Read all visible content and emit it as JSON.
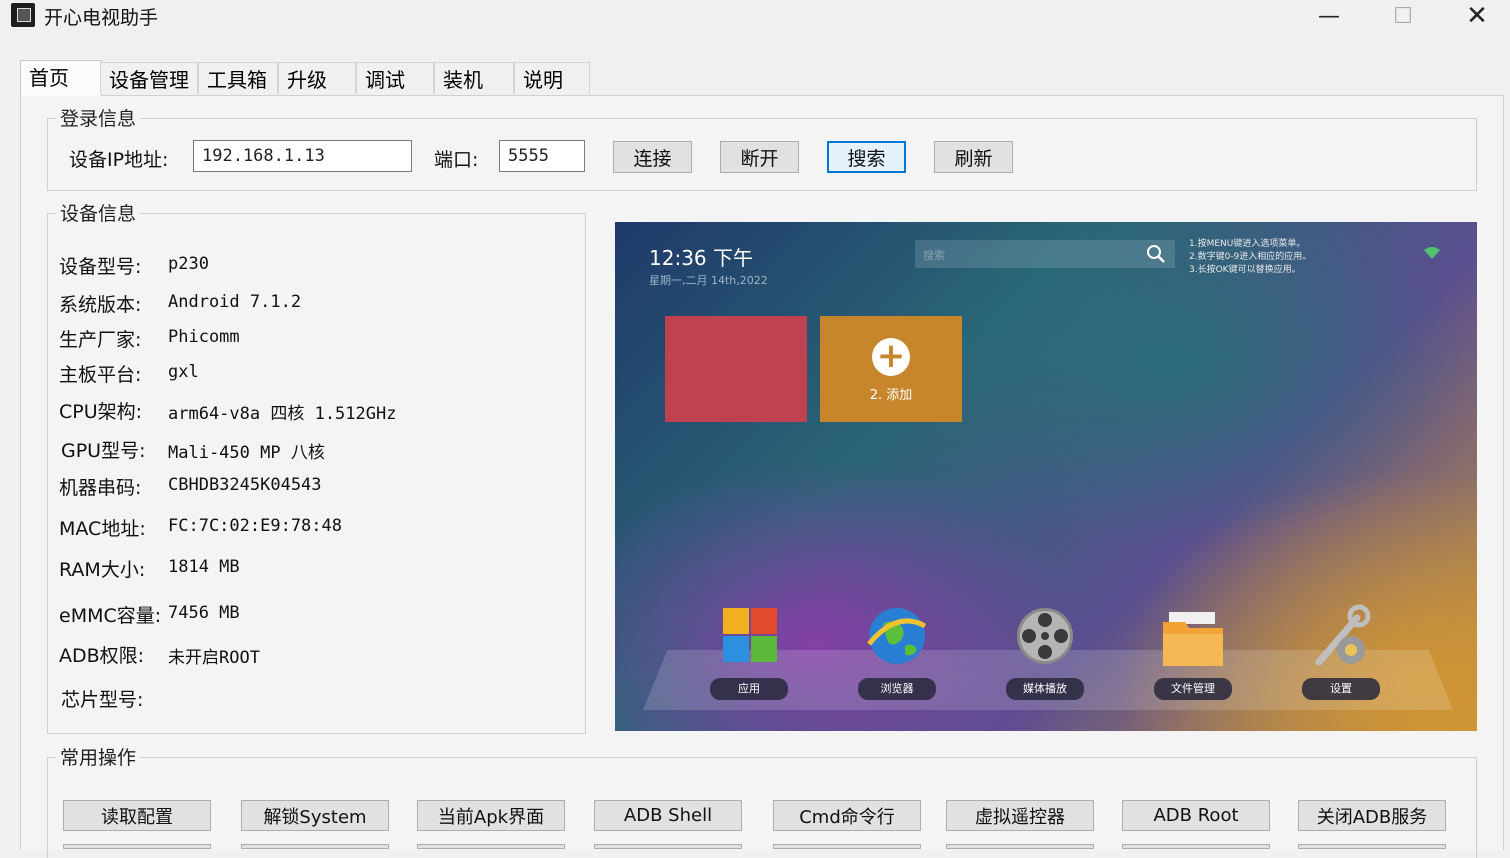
{
  "window": {
    "title": "开心电视助手",
    "minimize": "—",
    "maximize": "☐",
    "close": "✕"
  },
  "tabs": [
    {
      "label": "首页"
    },
    {
      "label": "设备管理"
    },
    {
      "label": "工具箱"
    },
    {
      "label": "升级"
    },
    {
      "label": "调试"
    },
    {
      "label": "装机"
    },
    {
      "label": "说明"
    }
  ],
  "login": {
    "title": "登录信息",
    "ip_label": "设备IP地址:",
    "ip_value": "192.168.1.13",
    "port_label": "端口:",
    "port_value": "5555",
    "connect": "连接",
    "disconnect": "断开",
    "search": "搜索",
    "refresh": "刷新"
  },
  "device": {
    "title": "设备信息",
    "rows": [
      {
        "label": "设备型号:",
        "value": "p230"
      },
      {
        "label": "系统版本:",
        "value": "Android 7.1.2"
      },
      {
        "label": "生产厂家:",
        "value": "Phicomm"
      },
      {
        "label": "主板平台:",
        "value": "gxl"
      },
      {
        "label": "CPU架构:",
        "value": "arm64-v8a 四核 1.512GHz"
      },
      {
        "label": "GPU型号:",
        "value": "Mali-450 MP 八核"
      },
      {
        "label": "机器串码:",
        "value": "CBHDB3245K04543"
      },
      {
        "label": "MAC地址:",
        "value": "FC:7C:02:E9:78:48"
      },
      {
        "label": "RAM大小:",
        "value": "1814 MB"
      },
      {
        "label": "eMMC容量:",
        "value": "7456 MB"
      },
      {
        "label": "ADB权限:",
        "value": "未开启ROOT"
      },
      {
        "label": "芯片型号:",
        "value": ""
      }
    ]
  },
  "tv": {
    "time": "12:36 下午",
    "date": "星期一,二月 14th,2022",
    "search_placeholder": "搜索",
    "tips": [
      "1.按MENU键进入选项菜单。",
      "2.数字键0-9进入相应的应用。",
      "3.长按OK键可以替换应用。"
    ],
    "add_label": "2. 添加",
    "dock": [
      {
        "label": "应用",
        "icon": "windows-apps-icon"
      },
      {
        "label": "浏览器",
        "icon": "globe-browser-icon"
      },
      {
        "label": "媒体播放",
        "icon": "film-reel-icon"
      },
      {
        "label": "文件管理",
        "icon": "folder-icon"
      },
      {
        "label": "设置",
        "icon": "wrench-gear-icon"
      }
    ],
    "colors": {
      "tile_red": "#c0414f",
      "tile_orange": "#c7862b"
    }
  },
  "ops": {
    "title": "常用操作",
    "buttons": [
      {
        "label": "读取配置"
      },
      {
        "label": "解锁System"
      },
      {
        "label": "当前Apk界面"
      },
      {
        "label": "ADB Shell"
      },
      {
        "label": "Cmd命令行"
      },
      {
        "label": "虚拟遥控器"
      },
      {
        "label": "ADB  Root"
      },
      {
        "label": "关闭ADB服务"
      }
    ]
  }
}
